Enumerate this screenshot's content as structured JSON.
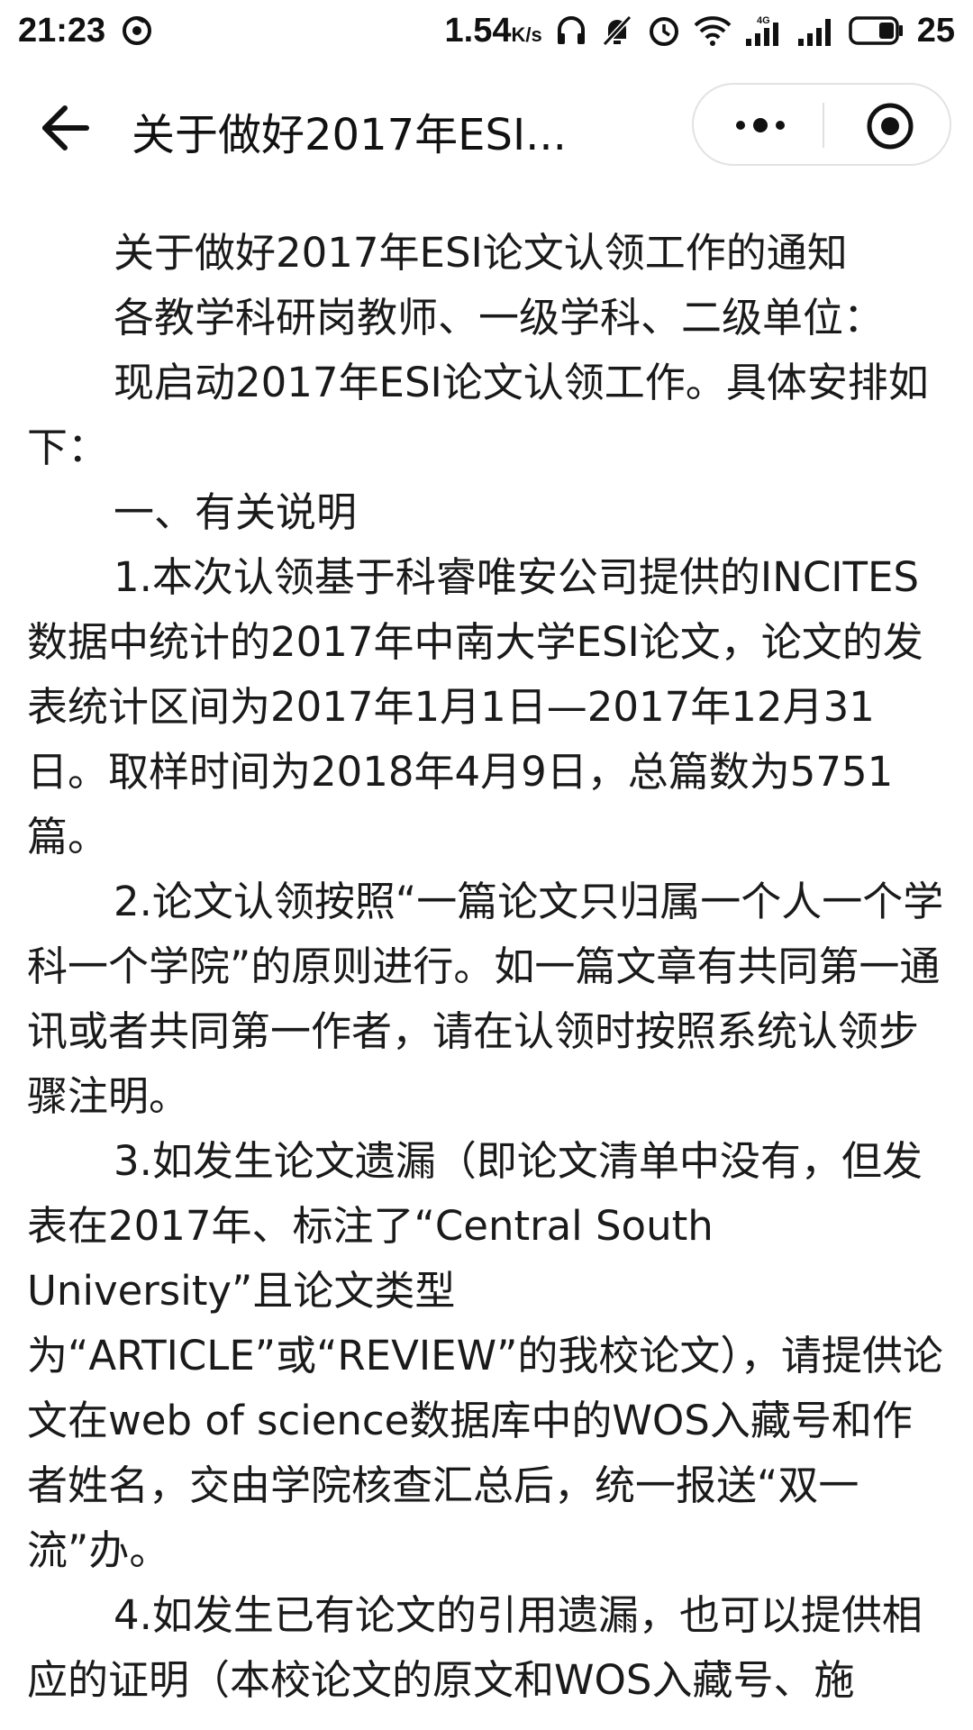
{
  "status_bar": {
    "time": "21:23",
    "speed_value": "1.54",
    "speed_unit": "K/s",
    "battery": "25",
    "network": "4G",
    "icons": [
      "sync-icon",
      "headphones-icon",
      "mute-icon",
      "alarm-icon",
      "wifi-icon",
      "signal-4g-icon",
      "signal-icon",
      "battery-icon"
    ]
  },
  "nav": {
    "title": "关于做好2017年ESI...",
    "back_icon": "arrow-left-icon",
    "more_icon": "more-dots-icon",
    "close_icon": "target-close-icon"
  },
  "article": {
    "paragraphs": [
      "关于做好2017年ESI论文认领工作的通知",
      "各教学科研岗教师、一级学科、二级单位：",
      "现启动2017年ESI论文认领工作。具体安排如下：",
      "一、有关说明",
      "1.本次认领基于科睿唯安公司提供的INCITES数据中统计的2017年中南大学ESI论文，论文的发表统计区间为2017年1月1日—2017年12月31日。取样时间为2018年4月9日，总篇数为5751篇。",
      "2.论文认领按照“一篇论文只归属一个人一个学科一个学院”的原则进行。如一篇文章有共同第一通讯或者共同第一作者，请在认领时按照系统认领步骤注明。",
      "3.如发生论文遗漏（即论文清单中没有，但发表在2017年、标注了“Central South University”且论文类型为“ARTICLE”或“REVIEW”的我校论文），请提供论文在web of science数据库中的WOS入藏号和作者姓名，交由学院核查汇总后，统一报送“双一流”办。",
      "4.如发生已有论文的引用遗漏，也可以提供相应的证明（本校论文的原文和WOS入藏号、施"
    ]
  }
}
